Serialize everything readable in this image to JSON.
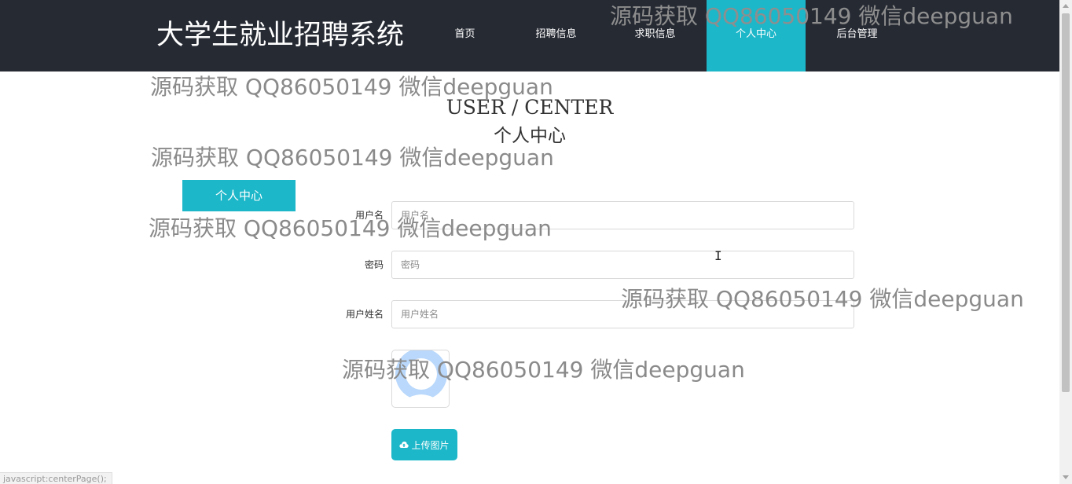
{
  "brand": {
    "title": "大学生就业招聘系统"
  },
  "nav": {
    "items": [
      {
        "label": "首页"
      },
      {
        "label": "招聘信息"
      },
      {
        "label": "求职信息"
      },
      {
        "label": "个人中心",
        "active": true
      },
      {
        "label": "后台管理"
      }
    ]
  },
  "page": {
    "heading_en": "USER / CENTER",
    "heading_cn": "个人中心",
    "side_tab": "个人中心"
  },
  "form": {
    "username": {
      "label": "用户名",
      "placeholder": "用户名",
      "value": ""
    },
    "password": {
      "label": "密码",
      "placeholder": "密码",
      "value": ""
    },
    "fullname": {
      "label": "用户姓名",
      "placeholder": "用户姓名",
      "value": ""
    },
    "upload_label": "上传图片"
  },
  "watermark": {
    "text": "源码获取 QQ86050149 微信deepguan"
  },
  "status": {
    "text": "javascript:centerPage();"
  },
  "colors": {
    "accent": "#1cb7c9",
    "topbar": "#262a33"
  },
  "icons": {
    "upload": "cloud-upload-icon",
    "avatar": "avatar-placeholder-icon"
  }
}
